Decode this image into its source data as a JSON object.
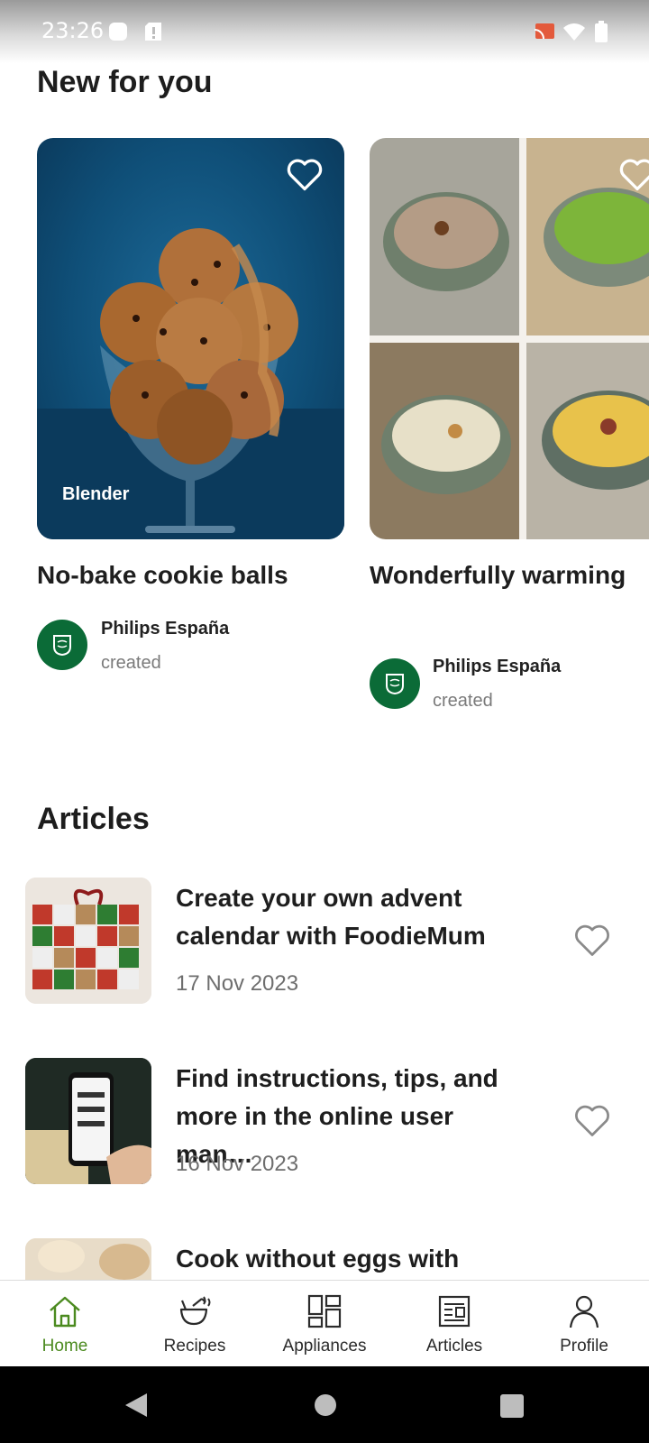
{
  "status_bar": {
    "time": "23:26"
  },
  "new_for_you": {
    "title": "New for you",
    "cards": [
      {
        "title": "No-bake cookie balls",
        "tag": "Blender",
        "author": "Philips España",
        "author_role": "created"
      },
      {
        "title": "Wonderfully warming",
        "author": "Philips España",
        "author_role": "created"
      }
    ]
  },
  "articles": {
    "title": "Articles",
    "items": [
      {
        "title_line1": "Create your own advent",
        "title_line2": "calendar with FoodieMum",
        "date": "17 Nov 2023"
      },
      {
        "title_line1": "Find instructions, tips, and",
        "title_line2": "more in the online user man…",
        "date": "16 Nov 2023"
      },
      {
        "title_line1": "Cook without eggs with"
      }
    ]
  },
  "bottom_nav": {
    "items": [
      {
        "label": "Home",
        "icon": "home-icon",
        "active": true
      },
      {
        "label": "Recipes",
        "icon": "recipes-icon"
      },
      {
        "label": "Appliances",
        "icon": "appliances-icon"
      },
      {
        "label": "Articles",
        "icon": "articles-icon"
      },
      {
        "label": "Profile",
        "icon": "profile-icon"
      }
    ]
  },
  "colors": {
    "accent_green": "#4b8a1f",
    "brand_green": "#0b6b37",
    "card_blue": "#0f4f78"
  }
}
